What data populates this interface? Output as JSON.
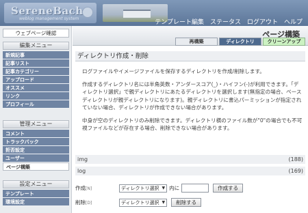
{
  "header": {
    "logo_title": "SereneBach",
    "logo_subtitle": "weblog management system",
    "nav": [
      "テンプレート編集",
      "ステータス",
      "ログアウト",
      "ヘルプ"
    ]
  },
  "sidebar": {
    "top_button": "ウェブページ確認",
    "sections": [
      {
        "title": "編集メニュー",
        "items": [
          "新規記事",
          "記事リスト",
          "記事カテゴリー",
          "アップロード",
          "オススメ",
          "リンク",
          "プロフィール"
        ]
      },
      {
        "title": "管理メニュー",
        "items": [
          "コメント",
          "トラックバック",
          "拒否設定",
          "ユーザー",
          "ページ構築"
        ]
      },
      {
        "title": "設定メニュー",
        "items": [
          "テンプレート",
          "環境設定"
        ]
      }
    ],
    "active_item": "ページ構築"
  },
  "main": {
    "page_title": "ページ構築",
    "tabs": [
      "再構築",
      "ディレクトリ",
      "クリーンアップ"
    ],
    "active_tab": "ディレクトリ",
    "section_title": "ディレクトリ作成・削除",
    "paragraphs": [
      "ログファイルやイメージファイルを保存するディレクトリを作成/削除します。",
      "作成するディレクトリ名には半角英数・アンダースコア(_)・ハイフン(-)が利用できます。「ディレクトリ選択」で親ディレクトリにあたるディレクトリを選択します(無指定の場合、ベースディレクトリが親ディレクトリになります)。親ディレクトリに書込パーミッションが指定されていない場合、ディレクトリが作成できない場合があります。",
      "中身が空のディレクトリのみ削除できます。ディレクトリ横のファイル数が\"0\"の場合でも不可視ファイルなどが存在する場合、削除できない場合があります。"
    ],
    "directories": [
      {
        "name": "img",
        "count": "(188)"
      },
      {
        "name": "log",
        "count": "(169)"
      }
    ],
    "create_form": {
      "label": "作成",
      "shortcut": "[N]",
      "select_value": "ディレクトリ選択",
      "in_text": "内に",
      "button": "作成する"
    },
    "delete_form": {
      "label": "削除",
      "shortcut": "[D]",
      "select_value": "ディレクトリ選択",
      "button": "削除する"
    }
  }
}
